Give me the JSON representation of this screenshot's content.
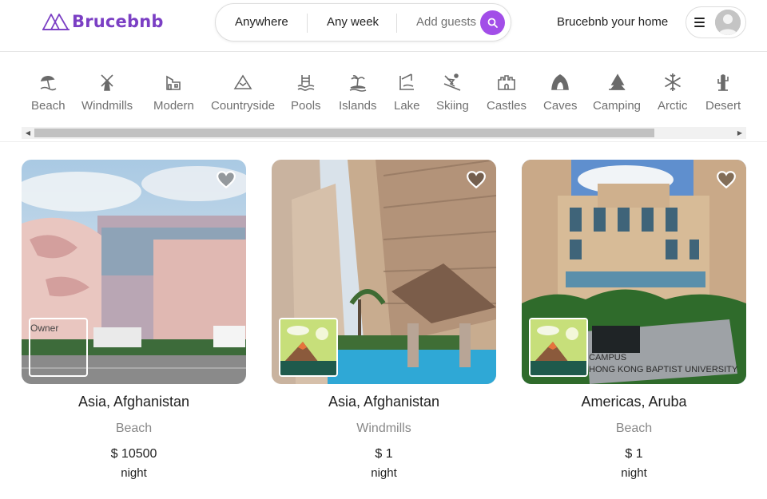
{
  "header": {
    "brand": "Brucebnb",
    "search": {
      "where": "Anywhere",
      "when": "Any week",
      "who": "Add guests"
    },
    "host_link": "Brucebnb your home"
  },
  "categories": [
    {
      "label": "Beach",
      "icon": "beach-icon"
    },
    {
      "label": "Windmills",
      "icon": "windmill-icon"
    },
    {
      "label": "Modern",
      "icon": "modern-house-icon"
    },
    {
      "label": "Countryside",
      "icon": "mountain-icon"
    },
    {
      "label": "Pools",
      "icon": "pool-icon"
    },
    {
      "label": "Islands",
      "icon": "island-icon"
    },
    {
      "label": "Lake",
      "icon": "lake-icon"
    },
    {
      "label": "Skiing",
      "icon": "skiing-icon"
    },
    {
      "label": "Castles",
      "icon": "castle-icon"
    },
    {
      "label": "Caves",
      "icon": "cave-icon"
    },
    {
      "label": "Camping",
      "icon": "camping-icon"
    },
    {
      "label": "Arctic",
      "icon": "snowflake-icon"
    },
    {
      "label": "Desert",
      "icon": "cactus-icon"
    }
  ],
  "listings": [
    {
      "title": "Asia, Afghanistan",
      "category": "Beach",
      "price": "$ 10500",
      "unit": "night",
      "owner_alt": "Owner"
    },
    {
      "title": "Asia, Afghanistan",
      "category": "Windmills",
      "price": "$ 1",
      "unit": "night"
    },
    {
      "title": "Americas, Aruba",
      "category": "Beach",
      "price": "$ 1",
      "unit": "night",
      "photo_sign": [
        "CAMPUS",
        "HONG KONG BAPTIST UNIVERSITY"
      ]
    }
  ],
  "colors": {
    "brand": "#7b3fc4",
    "search_button": "#a24ee8",
    "muted_text": "#717171"
  }
}
